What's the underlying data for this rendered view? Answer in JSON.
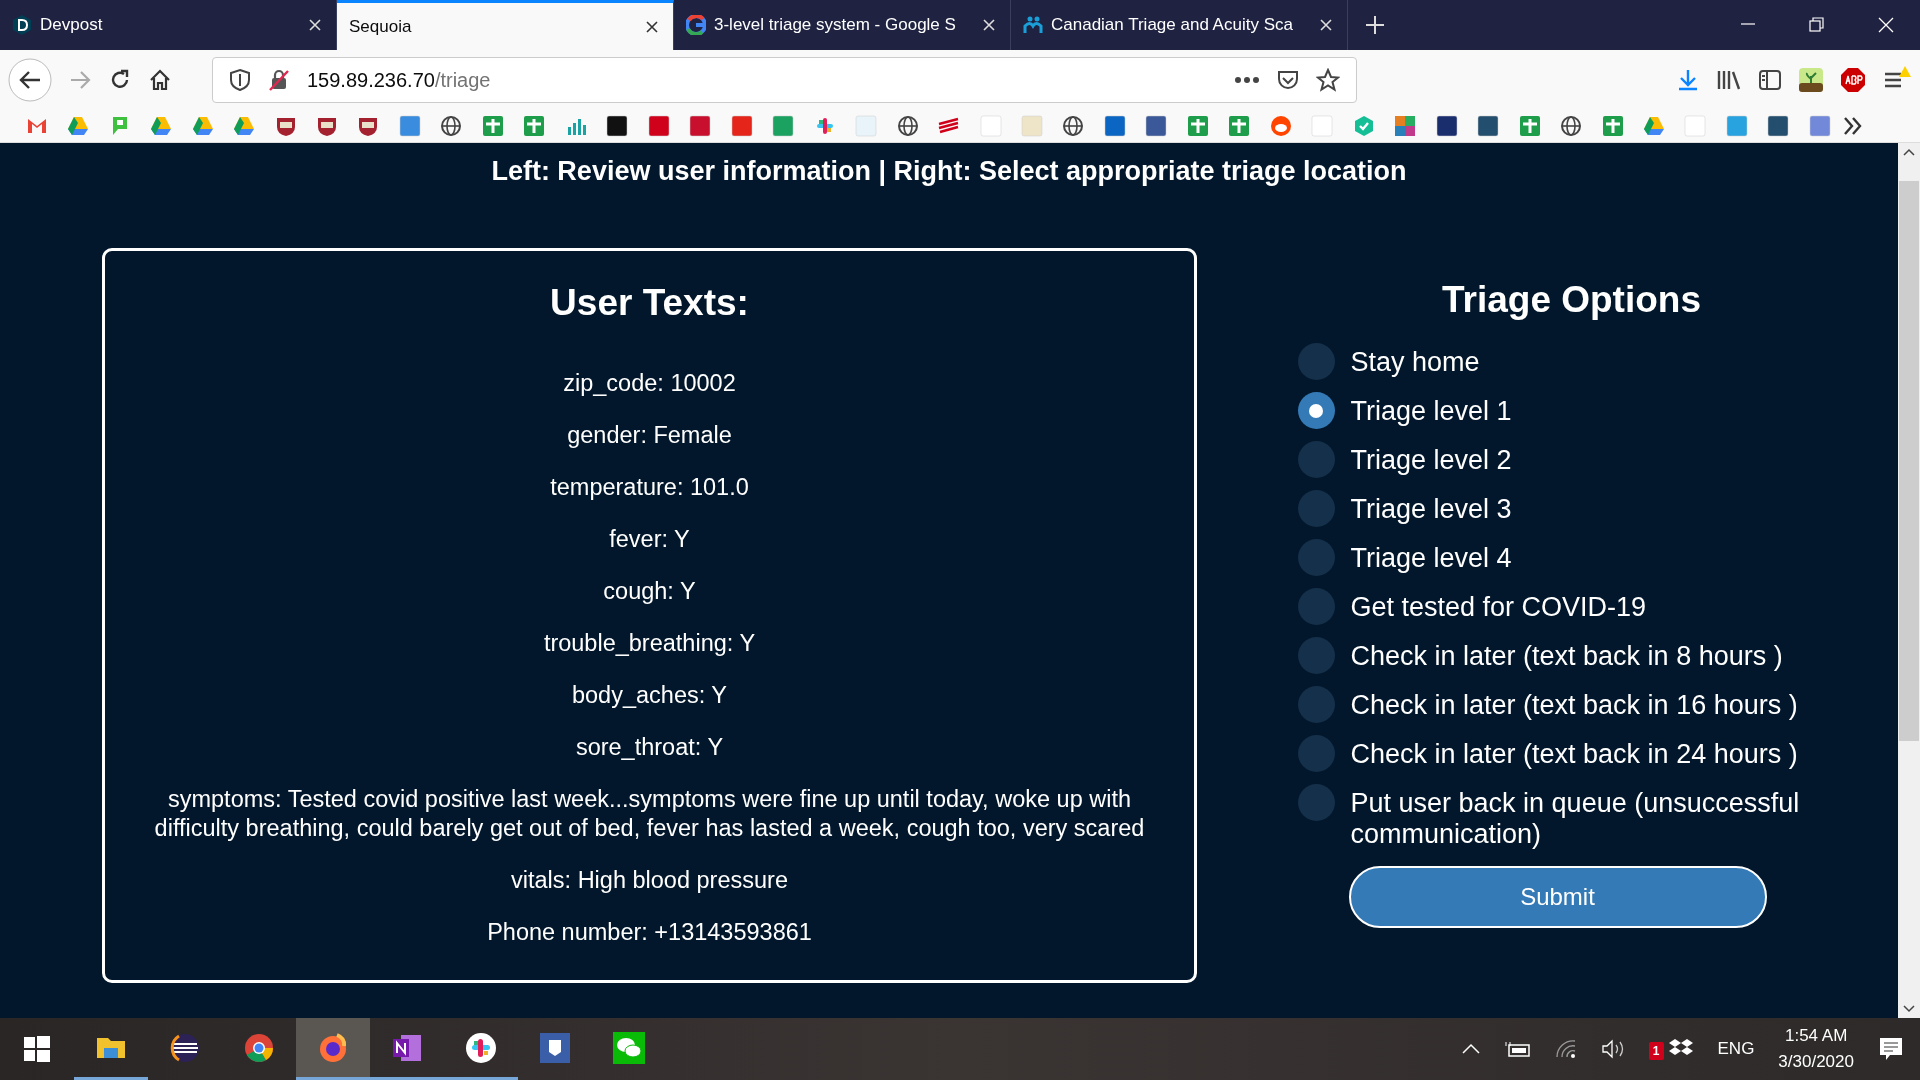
{
  "browser": {
    "tabs": [
      {
        "title": "Devpost",
        "selected": false
      },
      {
        "title": "Sequoia",
        "selected": true
      },
      {
        "title": "3-level triage system - Google S",
        "selected": false
      },
      {
        "title": "Canadian Triage and Acuity Sca",
        "selected": false
      }
    ],
    "address": {
      "host": "159.89.236.70",
      "path": "/triage"
    }
  },
  "page": {
    "instructions": "Left: Review user information | Right: Select appropriate triage location",
    "user_texts": {
      "title": "User Texts:",
      "lines": [
        "zip_code: 10002",
        "gender: Female",
        "temperature: 101.0",
        "fever: Y",
        "cough: Y",
        "trouble_breathing: Y",
        "body_aches: Y",
        "sore_throat: Y",
        "symptoms: Tested covid positive last week...symptoms were fine up until today, woke up with difficulty breathing, could barely get out of bed, fever has lasted a week, cough too, very scared",
        "vitals: High blood pressure",
        "Phone number: +13143593861"
      ]
    },
    "triage": {
      "title": "Triage Options",
      "options": [
        {
          "label": "Stay home",
          "selected": false
        },
        {
          "label": "Triage level 1",
          "selected": true
        },
        {
          "label": "Triage level 2",
          "selected": false
        },
        {
          "label": "Triage level 3",
          "selected": false
        },
        {
          "label": "Triage level 4",
          "selected": false
        },
        {
          "label": "Get tested for COVID-19",
          "selected": false
        },
        {
          "label": "Check in later (text back in 8 hours )",
          "selected": false
        },
        {
          "label": "Check in later (text back in 16 hours )",
          "selected": false
        },
        {
          "label": "Check in later (text back in 24 hours )",
          "selected": false
        },
        {
          "label": "Put user back in queue (unsuccessful communication)",
          "selected": false
        }
      ],
      "submit": "Submit"
    }
  },
  "taskbar": {
    "apps": [
      {
        "running": true,
        "selected": false
      },
      {
        "running": false,
        "selected": false
      },
      {
        "running": false,
        "selected": false
      },
      {
        "running": true,
        "selected": true
      },
      {
        "running": true,
        "selected": false
      },
      {
        "running": true,
        "selected": false
      },
      {
        "running": false,
        "selected": false
      },
      {
        "running": false,
        "selected": false
      }
    ],
    "dropbox_badge": "1",
    "language": "ENG",
    "time": "1:54 AM",
    "date": "3/30/2020"
  }
}
